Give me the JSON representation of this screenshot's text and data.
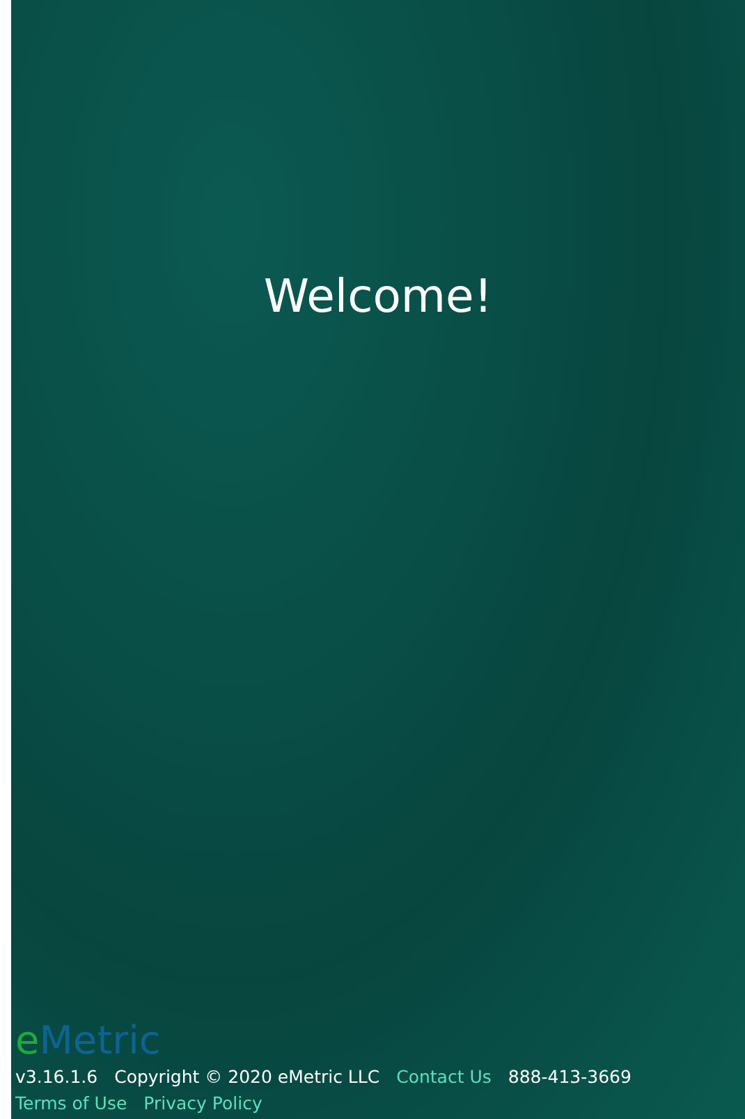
{
  "heading": "Welcome!",
  "logo": {
    "first": "e",
    "rest": "Metric"
  },
  "footer": [
    {
      "kind": "text",
      "text": "v3.16.1.6"
    },
    {
      "kind": "text",
      "text": "Copyright © 2020 eMetric LLC"
    },
    {
      "kind": "link",
      "text": "Contact Us"
    },
    {
      "kind": "text",
      "text": "888-413-3669"
    },
    {
      "kind": "link",
      "text": "Terms of Use"
    },
    {
      "kind": "link",
      "text": "Privacy Policy"
    }
  ]
}
